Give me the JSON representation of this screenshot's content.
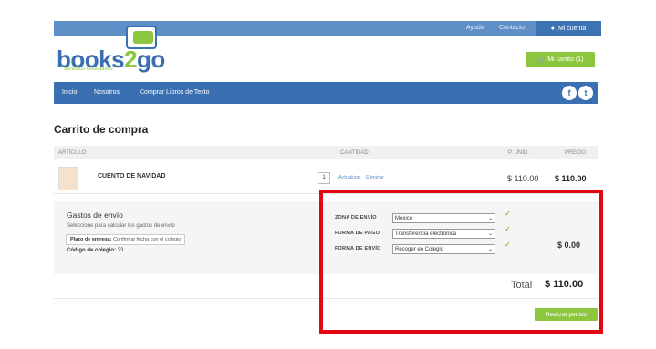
{
  "colors": {
    "brand_blue": "#3a6fb1",
    "brand_green": "#8cc63f",
    "highlight_red": "#e30613"
  },
  "topbar": {
    "help": "Ayuda",
    "contact": "Contacto",
    "account": "Mi cuenta"
  },
  "logo": {
    "text_main": "books",
    "text_two": "2",
    "text_go": "go",
    "tagline": "servicios educativos"
  },
  "cart_button": "Mi carrito (1)",
  "nav": {
    "items": [
      "Inicio",
      "Nosotros",
      "Comprar Libros de Texto"
    ],
    "social": [
      "f",
      "t"
    ]
  },
  "page_title": "Carrito de compra",
  "table": {
    "headers": {
      "article": "ARTÍCULO",
      "quantity": "CANTIDAD",
      "unit_price": "P. UNID.",
      "price": "PRECIO"
    },
    "rows": [
      {
        "name": "CUENTO DE NAVIDAD",
        "quantity": "1",
        "update": "Actualizar",
        "remove": "Eliminar",
        "unit_price": "$ 110.00",
        "price": "$ 110.00"
      }
    ]
  },
  "shipping": {
    "title": "Gastos de envío",
    "subtitle": "Seleccione para calcular los gastos de envío",
    "deadline_label": "Plazo de entrega:",
    "deadline_value": "Confirmar fecha con el colegio",
    "school_code_label": "Código de colegio:",
    "school_code_value": "23",
    "fields": [
      {
        "label": "ZONA DE ENVÍO",
        "value": "México"
      },
      {
        "label": "FORMA DE PAGO",
        "value": "Transferencia electrónica"
      },
      {
        "label": "FORMA DE ENVÍO",
        "value": "Recoger en Colegio"
      }
    ],
    "cost": "$ 0.00"
  },
  "total": {
    "label": "Total",
    "value": "$ 110.00"
  },
  "order_button": "Realizar pedido"
}
